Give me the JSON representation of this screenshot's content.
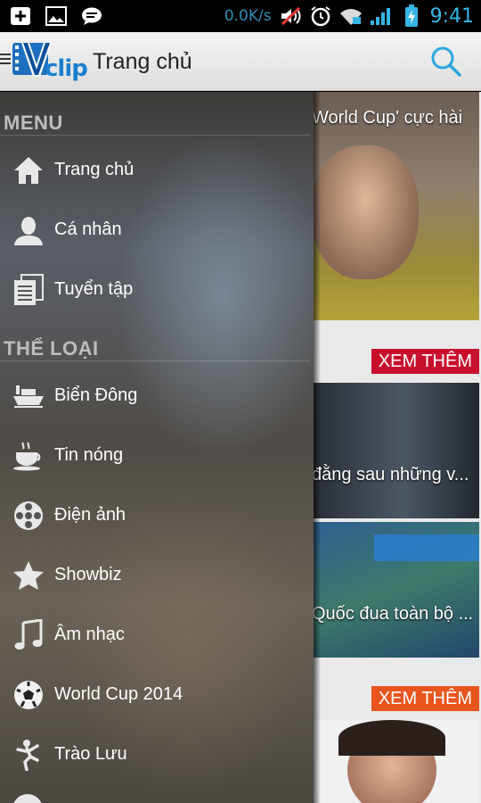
{
  "status_bar": {
    "speed": "0.0K/s",
    "time": "9:41"
  },
  "app_bar": {
    "logo_text": "clip",
    "title": "Trang chủ"
  },
  "drawer": {
    "menu_header": "MENU",
    "menu_items": [
      {
        "label": "Trang chủ",
        "icon": "home-icon"
      },
      {
        "label": "Cá nhân",
        "icon": "person-icon"
      },
      {
        "label": "Tuyển tập",
        "icon": "collection-icon"
      }
    ],
    "category_header": "THỂ LOẠI",
    "categories": [
      {
        "label": "Biển Đông",
        "icon": "ship-icon"
      },
      {
        "label": "Tin nóng",
        "icon": "coffee-icon"
      },
      {
        "label": "Điện ảnh",
        "icon": "film-reel-icon"
      },
      {
        "label": "Showbiz",
        "icon": "star-icon"
      },
      {
        "label": "Âm nhạc",
        "icon": "music-note-icon"
      },
      {
        "label": "World Cup 2014",
        "icon": "soccer-ball-icon"
      },
      {
        "label": "Trào Lưu",
        "icon": "dancer-icon"
      }
    ]
  },
  "content": {
    "cards": [
      {
        "title": "World Cup' cực hài"
      },
      {
        "title": "đằng sau những v..."
      },
      {
        "title": "Quốc đua toàn bộ ..."
      }
    ],
    "more_buttons": [
      "XEM THÊM",
      "XEM THÊM"
    ],
    "colors": {
      "more_red": "#c8102e",
      "more_orange": "#e8551d",
      "accent_blue": "#37b5e5"
    }
  }
}
